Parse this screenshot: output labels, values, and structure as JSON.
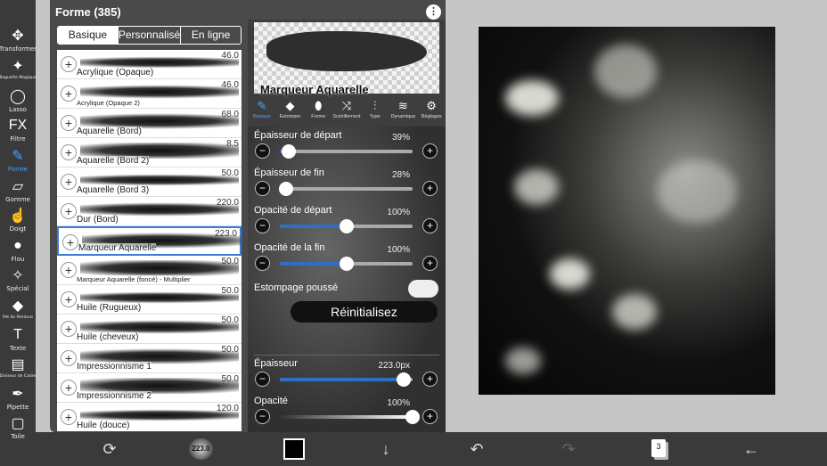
{
  "toolbar": {
    "tools": [
      {
        "label": "Transformer",
        "icon": "move-arrows-icon",
        "glyph": "✥",
        "active": false
      },
      {
        "label": "Baguette Magique",
        "icon": "magic-wand-icon",
        "glyph": "✦",
        "active": false
      },
      {
        "label": "Lasso",
        "icon": "lasso-icon",
        "glyph": "◯",
        "active": false
      },
      {
        "label": "Filtre",
        "icon": "fx-icon",
        "glyph": "FX",
        "active": false
      },
      {
        "label": "Forme",
        "icon": "brush-icon",
        "glyph": "✎",
        "active": true
      },
      {
        "label": "Gomme",
        "icon": "eraser-icon",
        "glyph": "▱",
        "active": false
      },
      {
        "label": "Doigt",
        "icon": "finger-icon",
        "glyph": "☝",
        "active": false
      },
      {
        "label": "Flou",
        "icon": "drop-icon",
        "glyph": "●",
        "active": false
      },
      {
        "label": "Spécial",
        "icon": "sparkle-icon",
        "glyph": "✧",
        "active": false
      },
      {
        "label": "Pot de Peinture",
        "icon": "paint-bucket-icon",
        "glyph": "◆",
        "active": false
      },
      {
        "label": "Texte",
        "icon": "text-icon",
        "glyph": "T",
        "active": false
      },
      {
        "label": "Diviseur de Cadre",
        "icon": "frame-divider-icon",
        "glyph": "▤",
        "active": false
      },
      {
        "label": "Pipette",
        "icon": "eyedropper-icon",
        "glyph": "✒",
        "active": false
      },
      {
        "label": "Toile",
        "icon": "canvas-icon",
        "glyph": "▢",
        "active": false
      }
    ]
  },
  "panel": {
    "title": "Forme (385)",
    "menu_glyph": "⋮",
    "tabs": [
      "Basique",
      "Personnalisé",
      "En ligne"
    ]
  },
  "brushes": [
    {
      "name": "Acrylique (Opaque)",
      "size": "46.0",
      "selected": false,
      "small": false
    },
    {
      "name": "Acrylique (Opaque 2)",
      "size": "46.0",
      "selected": false,
      "small": true
    },
    {
      "name": "Aquarelle (Bord)",
      "size": "68.0",
      "selected": false,
      "small": false
    },
    {
      "name": "Aquarelle (Bord 2)",
      "size": "8.5",
      "selected": false,
      "small": false
    },
    {
      "name": "Aquarelle (Bord 3)",
      "size": "50.0",
      "selected": false,
      "small": false
    },
    {
      "name": "Dur (Bord)",
      "size": "220.0",
      "selected": false,
      "small": false
    },
    {
      "name": "Marqueur Aquarelle",
      "size": "223.0",
      "selected": true,
      "small": false
    },
    {
      "name": "Marqueur Aquarelle (foncé) - Multiplier",
      "size": "50.0",
      "selected": false,
      "small": true
    },
    {
      "name": "Huile (Rugueux)",
      "size": "50.0",
      "selected": false,
      "small": false
    },
    {
      "name": "Huile (cheveux)",
      "size": "50.0",
      "selected": false,
      "small": false
    },
    {
      "name": "Impressionnisme 1",
      "size": "50.0",
      "selected": false,
      "small": false
    },
    {
      "name": "Impressionnisme 2",
      "size": "50.0",
      "selected": false,
      "small": false
    },
    {
      "name": "Huile (douce)",
      "size": "120.0",
      "selected": false,
      "small": false
    }
  ],
  "settings": {
    "preview_name": "Marqueur Aquarelle",
    "sub_tabs": [
      {
        "label": "Basique",
        "icon": "brush-icon",
        "glyph": "✎",
        "active": true
      },
      {
        "label": "Estomper",
        "icon": "diamond-icon",
        "glyph": "◆",
        "active": false
      },
      {
        "label": "Forme",
        "icon": "leaf-icon",
        "glyph": "⬮",
        "active": false
      },
      {
        "label": "Scintillement",
        "icon": "shuffle-icon",
        "glyph": "⤨",
        "active": false
      },
      {
        "label": "Type",
        "icon": "type-sliders-icon",
        "glyph": "⫶",
        "active": false
      },
      {
        "label": "Dynamique",
        "icon": "dynamics-icon",
        "glyph": "≋",
        "active": false
      },
      {
        "label": "Réglages",
        "icon": "gear-icon",
        "glyph": "⚙",
        "active": false
      }
    ],
    "start_thickness": {
      "label": "Épaisseur de départ",
      "value": "39%",
      "level": 0.07
    },
    "end_thickness": {
      "label": "Épaisseur de fin",
      "value": "28%",
      "level": 0.05
    },
    "start_opacity": {
      "label": "Opacité de départ",
      "value": "100%",
      "level": 0.5
    },
    "end_opacity": {
      "label": "Opacité de la fin",
      "value": "100%",
      "level": 0.5
    },
    "stamp": {
      "label": "Estompage poussé",
      "on": false
    },
    "reset_label": "Réinitialisez",
    "thickness": {
      "label": "Épaisseur",
      "value": "223.0px",
      "level": 0.93
    },
    "opacity": {
      "label": "Opacité",
      "value": "100%",
      "level": 1.0
    },
    "minus_glyph": "−",
    "plus_glyph": "+"
  },
  "bottom_bar": {
    "brush_size": "223.0",
    "layer_count": "3",
    "icons": {
      "transform": "⟳",
      "down": "↓",
      "undo": "↶",
      "redo": "↷",
      "back": "←"
    }
  },
  "colors": {
    "accent": "#4aa3ff",
    "slider_fill": "#2e6fc2",
    "current_color": "#000000"
  }
}
